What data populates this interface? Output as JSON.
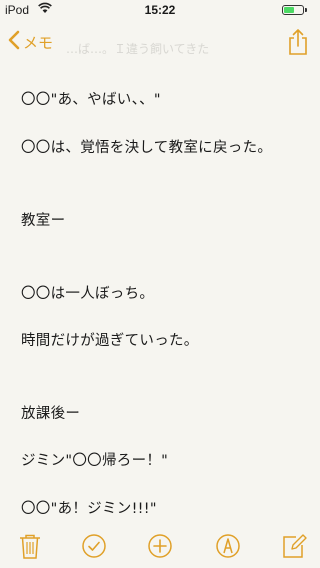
{
  "status_bar": {
    "carrier": "iPod",
    "time": "15:22",
    "battery_level": 0.55,
    "wifi_icon": "wifi-icon",
    "battery_color": "#4cd964"
  },
  "nav": {
    "back_label": "メモ",
    "accent_color": "#e0a028",
    "share_icon": "share-icon"
  },
  "ghost_text": "…ば…。Ｉ違う飼いてきた",
  "note": {
    "lines": [
      "〇〇\"あ、やばい、、\"",
      "〇〇は、覚悟を決して教室に戻った。",
      "教室ー",
      "〇〇は一人ぼっち。",
      "時間だけが過ぎていった。",
      "放課後ー",
      "ジミン\"〇〇帰ろー！\"",
      "〇〇\"あ！ジミン!!!\""
    ]
  },
  "toolbar": {
    "items": [
      "trash-icon",
      "checklist-icon",
      "add-icon",
      "markup-icon",
      "compose-icon"
    ]
  }
}
